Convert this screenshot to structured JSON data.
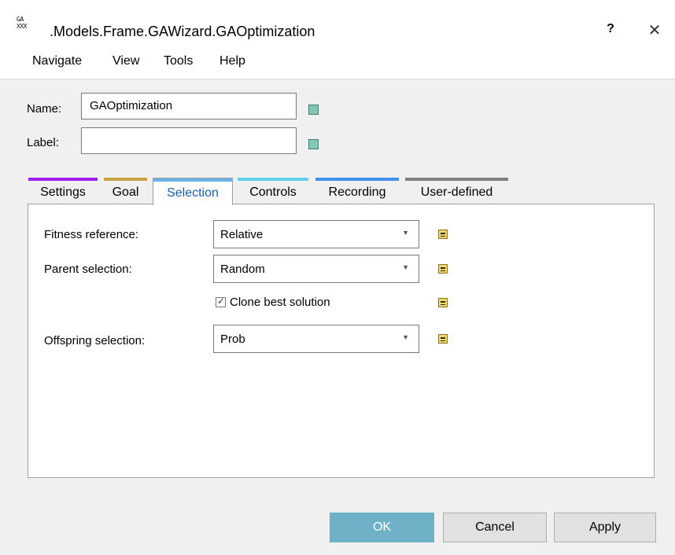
{
  "window": {
    "icon_text": "GA\nXXX",
    "title": ".Models.Frame.GAWizard.GAOptimization",
    "help_label": "?",
    "close_label": "✕"
  },
  "menu": [
    "Navigate",
    "View",
    "Tools",
    "Help"
  ],
  "fields": {
    "name_label": "Name:",
    "name_value": "GAOptimization",
    "label_label": "Label:",
    "label_value": ""
  },
  "tabs": [
    {
      "label": "Settings",
      "color": "#a020f0"
    },
    {
      "label": "Goal",
      "color": "#c8a040"
    },
    {
      "label": "Selection",
      "color": "#6ab0e8"
    },
    {
      "label": "Controls",
      "color": "#5fd0f0"
    },
    {
      "label": "Recording",
      "color": "#4090f0"
    },
    {
      "label": "User-defined",
      "color": "#808080"
    }
  ],
  "active_tab": "Selection",
  "selection": {
    "fitness_label": "Fitness reference:",
    "fitness_value": "Relative",
    "parent_label": "Parent selection:",
    "parent_value": "Random",
    "clone_label": "Clone best solution",
    "clone_checked": true,
    "offspring_label": "Offspring selection:",
    "offspring_value": "Prob"
  },
  "buttons": {
    "ok": "OK",
    "cancel": "Cancel",
    "apply": "Apply"
  }
}
